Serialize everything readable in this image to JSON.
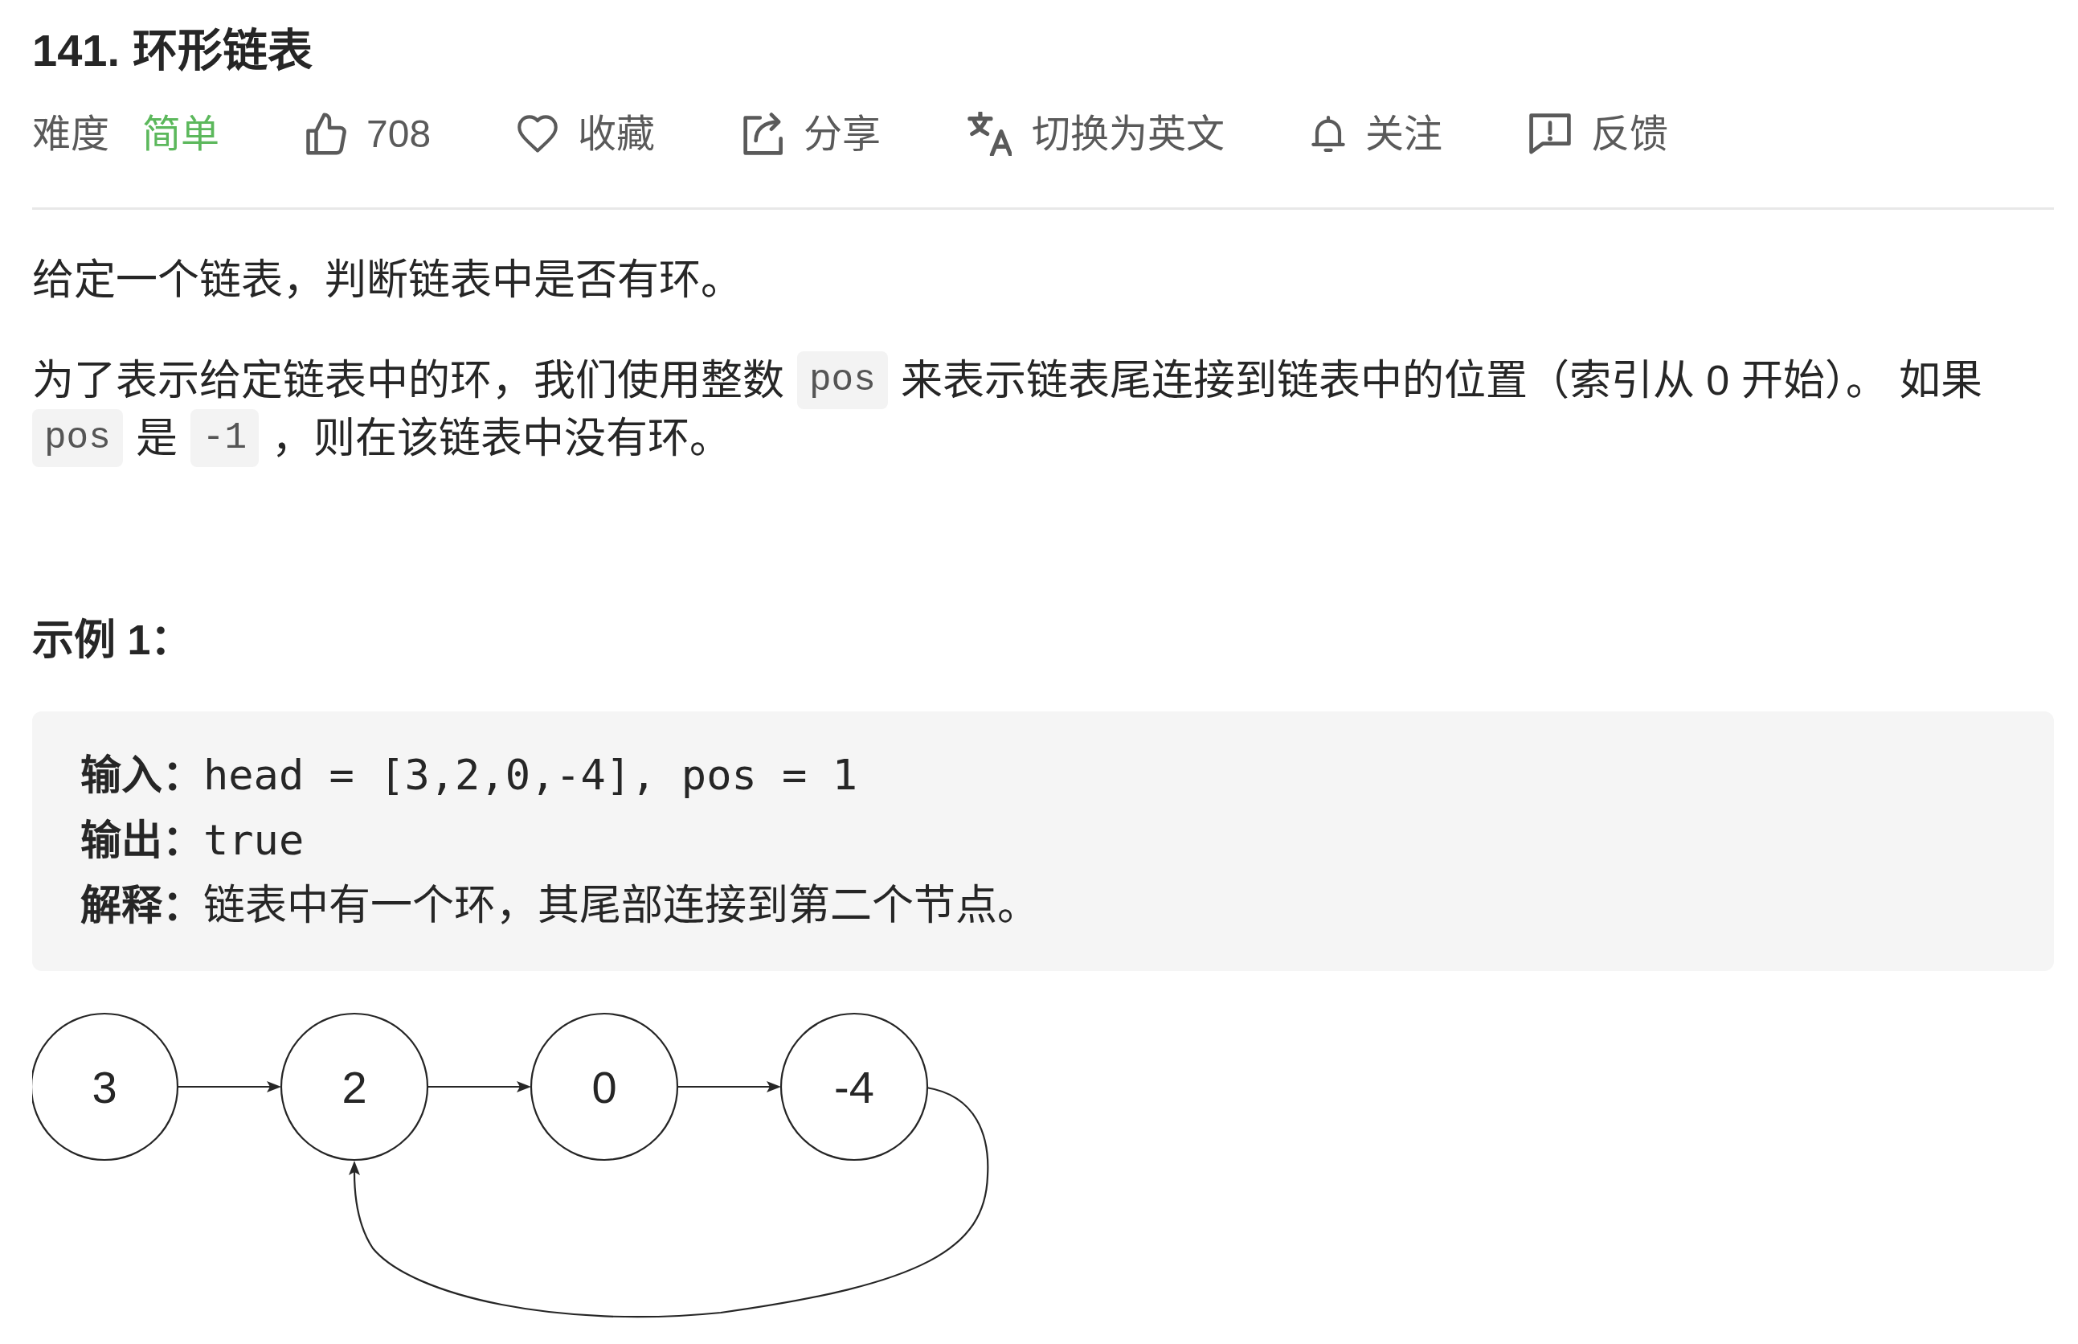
{
  "title": "141. 环形链表",
  "toolbar": {
    "difficulty": {
      "label": "难度",
      "value": "简单",
      "kind": "easy"
    },
    "actions": [
      {
        "kind": "like",
        "label": "708"
      },
      {
        "kind": "favorite",
        "label": "收藏"
      },
      {
        "kind": "share",
        "label": "分享"
      },
      {
        "kind": "translate",
        "label": "切换为英文"
      },
      {
        "kind": "follow",
        "label": "关注"
      },
      {
        "kind": "feedback",
        "label": "反馈"
      }
    ]
  },
  "description": [
    {
      "segments": [
        {
          "kind": "text",
          "text": "给定一个链表，判断链表中是否有环。"
        }
      ]
    },
    {
      "segments": [
        {
          "kind": "text",
          "text": "为了表示给定链表中的环，我们使用整数"
        },
        {
          "kind": "code",
          "text": "pos"
        },
        {
          "kind": "text",
          "text": "来表示链表尾连接到链表中的位置（索引从 0 开始）。 如果"
        },
        {
          "kind": "code",
          "text": "pos"
        },
        {
          "kind": "text",
          "text": "是"
        },
        {
          "kind": "code",
          "text": "-1"
        },
        {
          "kind": "text",
          "text": "，则在该链表中没有环。"
        }
      ]
    }
  ],
  "example": {
    "heading": "示例 1：",
    "lines": [
      {
        "label": "输入：",
        "value": "head = [3,2,0,-4], pos = 1"
      },
      {
        "label": "输出：",
        "value": "true"
      },
      {
        "label": "解释：",
        "value": "链表中有一个环，其尾部连接到第二个节点。"
      }
    ]
  },
  "diagram": {
    "nodes": [
      {
        "value": "3",
        "cycle_target": false
      },
      {
        "value": "2",
        "cycle_target": true
      },
      {
        "value": "0",
        "cycle_target": false
      },
      {
        "value": "-4",
        "cycle_target": false
      }
    ]
  }
}
